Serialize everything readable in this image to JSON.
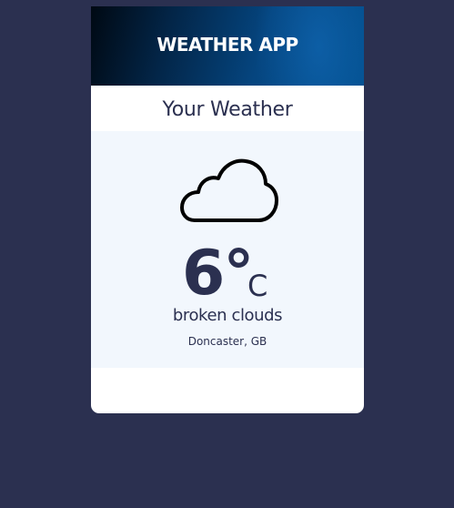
{
  "header": {
    "title": "WEATHER APP"
  },
  "subheader": {
    "title": "Your Weather"
  },
  "weather": {
    "icon": "cloud-icon",
    "temperature": "6°",
    "unit": "C",
    "conditions": "broken clouds",
    "location": "Doncaster, GB"
  },
  "colors": {
    "page_background": "#2b3050",
    "header_gradient_dark": "#000913",
    "header_gradient_light": "#03508f",
    "panel_background": "#f2f7fd",
    "text_primary": "#2b3050"
  }
}
